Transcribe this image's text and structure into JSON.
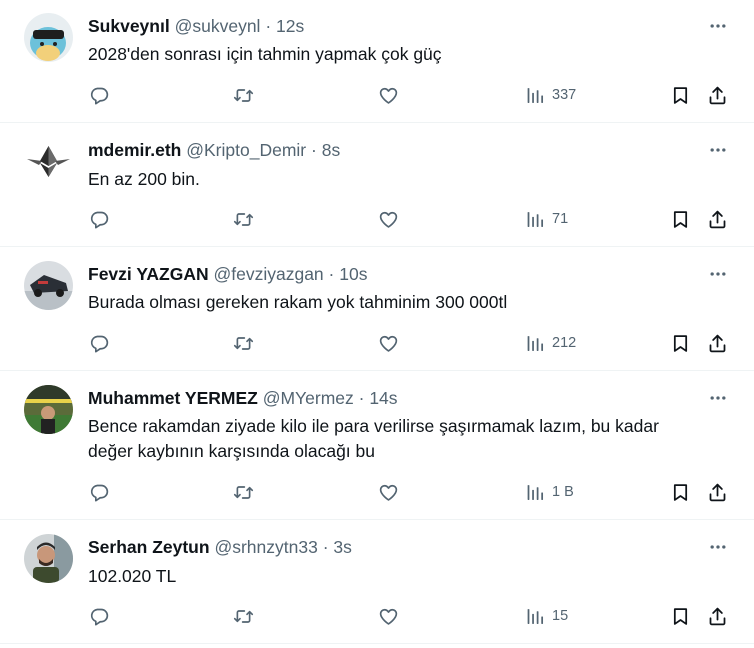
{
  "colors": {
    "text_primary": "#0f1419",
    "text_secondary": "#536471",
    "divider": "#eff3f4",
    "background": "#ffffff"
  },
  "icons": {
    "reply": "reply-icon",
    "retweet": "retweet-icon",
    "like": "like-icon",
    "views": "views-icon",
    "bookmark": "bookmark-icon",
    "share": "share-icon",
    "more": "more-icon"
  },
  "tweets": [
    {
      "name": "Sukveynıl",
      "handle": "@sukveynl",
      "dot": "·",
      "time": "12s",
      "text": "2028'den sonrası için tahmin yapmak çok güç",
      "views": "337"
    },
    {
      "name": "mdemir.eth",
      "handle": "@Kripto_Demir",
      "dot": "·",
      "time": "8s",
      "text": "En az 200 bin.",
      "views": "71"
    },
    {
      "name": "Fevzi YAZGAN",
      "handle": "@fevziyazgan",
      "dot": "·",
      "time": "10s",
      "text": "Burada olması gereken rakam yok tahminim 300 000tl",
      "views": "212"
    },
    {
      "name": "Muhammet YERMEZ",
      "handle": "@MYermez",
      "dot": "·",
      "time": "14s",
      "text_lines": [
        "Bence rakamdan ziyade kilo ile para verilirse şaşırmamak lazım, bu kadar",
        "değer kaybının karşısında olacağı bu"
      ],
      "views": "1 B"
    },
    {
      "name": "Serhan Zeytun",
      "handle": "@srhnzytn33",
      "dot": "·",
      "time": "3s",
      "text": "102.020 TL",
      "views": "15"
    }
  ]
}
